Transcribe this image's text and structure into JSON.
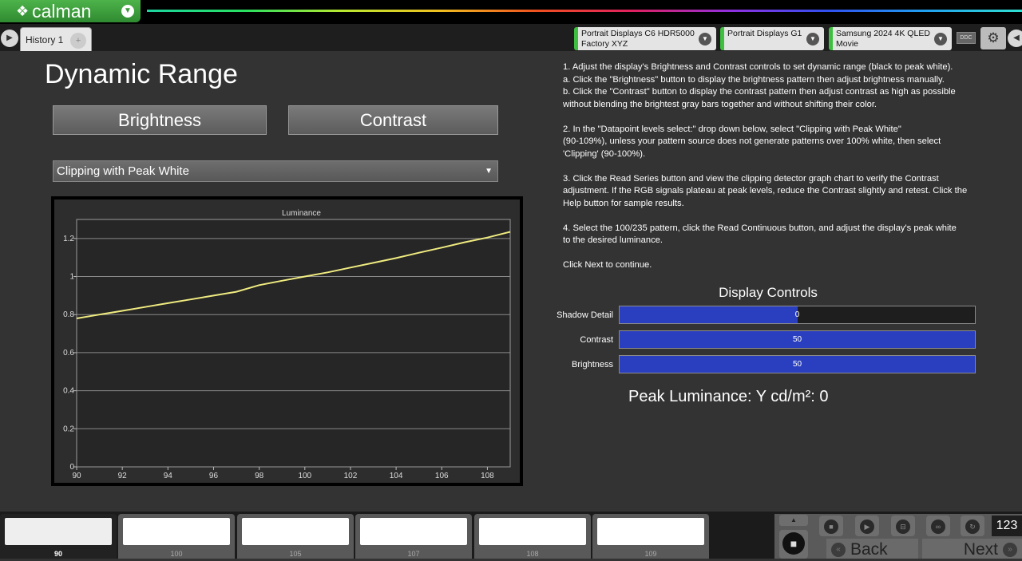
{
  "app": {
    "logo_text": "calman"
  },
  "tabs": {
    "history": "History 1",
    "add": "+"
  },
  "devices": [
    {
      "line1": "Portrait Displays C6 HDR5000",
      "line2": "Factory XYZ"
    },
    {
      "line1": "Portrait Displays G1",
      "line2": ""
    },
    {
      "line1": "Samsung 2024 4K QLED",
      "line2": "Movie"
    }
  ],
  "ddc_label": "DDC",
  "page": {
    "title": "Dynamic Range"
  },
  "buttons": {
    "brightness": "Brightness",
    "contrast": "Contrast"
  },
  "datapoint_select": {
    "value": "Clipping with Peak White"
  },
  "chart_data": {
    "type": "line",
    "title": "Luminance",
    "xlabel": "",
    "ylabel": "",
    "x": [
      90,
      91,
      92,
      93,
      94,
      95,
      96,
      97,
      98,
      99,
      100,
      101,
      102,
      103,
      104,
      105,
      106,
      107,
      108,
      109
    ],
    "series": [
      {
        "values": [
          0.78,
          0.8,
          0.82,
          0.84,
          0.86,
          0.88,
          0.9,
          0.92,
          0.955,
          0.978,
          1.0,
          1.022,
          1.047,
          1.072,
          1.097,
          1.125,
          1.152,
          1.18,
          1.205,
          1.235
        ],
        "color": "#f0ec80"
      }
    ],
    "xlim": [
      90,
      109
    ],
    "ylim": [
      0,
      1.3
    ],
    "xticks": [
      "90",
      "92",
      "94",
      "96",
      "98",
      "100",
      "102",
      "104",
      "106",
      "108"
    ],
    "yticks": [
      "0",
      "0.2",
      "0.4",
      "0.6",
      "0.8",
      "1",
      "1.2"
    ],
    "grid": true
  },
  "instructions": [
    [
      "1. Adjust the display's Brightness and Contrast controls to set dynamic range (black to peak white).",
      "a. Click the \"Brightness\" button to display the brightness pattern then adjust brightness manually.",
      "b. Click the \"Contrast\" button to display the contrast pattern then adjust contrast as high as possible",
      "without blending the brightest gray bars together and without shifting their color."
    ],
    [
      "2. In the \"Datapoint levels select:\" drop down below, select \"Clipping with Peak White\"",
      "(90-109%), unless your pattern source does not generate patterns over 100% white, then select",
      "'Clipping' (90-100%)."
    ],
    [
      "3. Click the Read Series button and view the clipping detector graph chart to verify the Contrast",
      "adjustment. If the RGB signals plateau at peak levels, reduce the Contrast slightly and retest. Click the",
      "Help button for sample results."
    ],
    [
      "4. Select the 100/235 pattern, click the Read Continuous button, and adjust the display's peak white",
      "to the desired luminance."
    ],
    [
      "Click Next to continue."
    ]
  ],
  "display_controls": {
    "title": "Display Controls",
    "items": [
      {
        "label": "Shadow Detail",
        "value": "0",
        "fill": 0.5
      },
      {
        "label": "Contrast",
        "value": "50",
        "fill": 1.0
      },
      {
        "label": "Brightness",
        "value": "50",
        "fill": 1.0
      }
    ]
  },
  "peak_luminance": "Peak Luminance:  Y cd/m²: 0",
  "swatches": [
    "90",
    "100",
    "105",
    "107",
    "108",
    "109"
  ],
  "counter": "123",
  "nav": {
    "back": "Back",
    "next": "Next"
  }
}
